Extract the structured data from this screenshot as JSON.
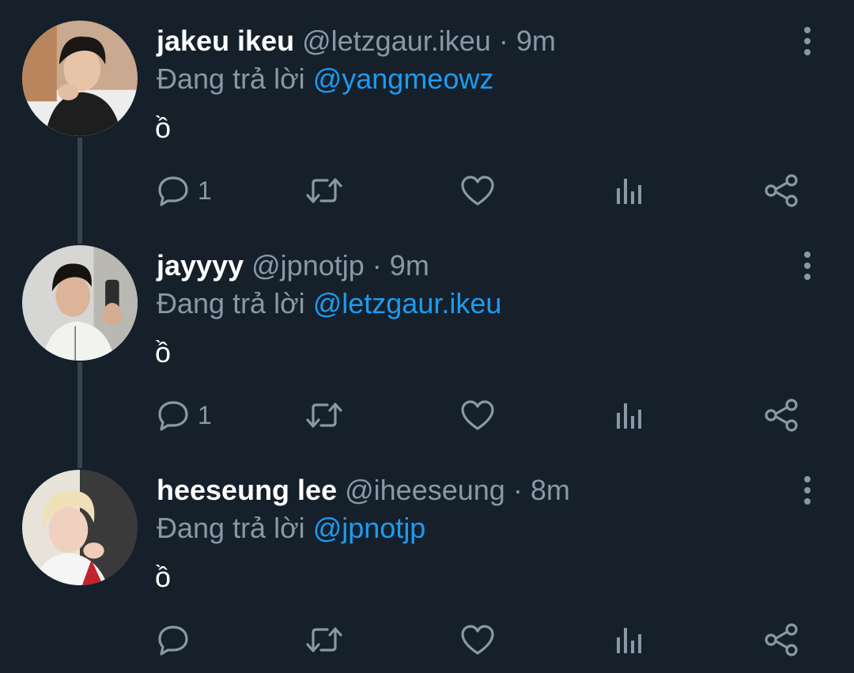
{
  "colors": {
    "background": "#15202b",
    "name": "#ffffff",
    "muted": "#8899a6",
    "mention": "#1d9bf0",
    "thread_line": "#38444d"
  },
  "labels": {
    "replying_prefix": "Đang trả lời"
  },
  "icons": [
    "reply-icon",
    "retweet-icon",
    "like-icon",
    "stats-icon",
    "share-icon",
    "more-options-icon"
  ],
  "tweets": [
    {
      "display_name": "jakeu ikeu",
      "handle": "@letzgaur.ikeu",
      "separator": "·",
      "time": "9m",
      "replying_to": "@yangmeowz",
      "text": "ồ",
      "reply_count": "1"
    },
    {
      "display_name": "jayyyy",
      "handle": "@jpnotjp",
      "separator": "·",
      "time": "9m",
      "replying_to": "@letzgaur.ikeu",
      "text": "ồ",
      "reply_count": "1"
    },
    {
      "display_name": "heeseung lee",
      "handle": "@iheeseung",
      "separator": "·",
      "time": "8m",
      "replying_to": "@jpnotjp",
      "text": "ồ",
      "reply_count": ""
    }
  ]
}
